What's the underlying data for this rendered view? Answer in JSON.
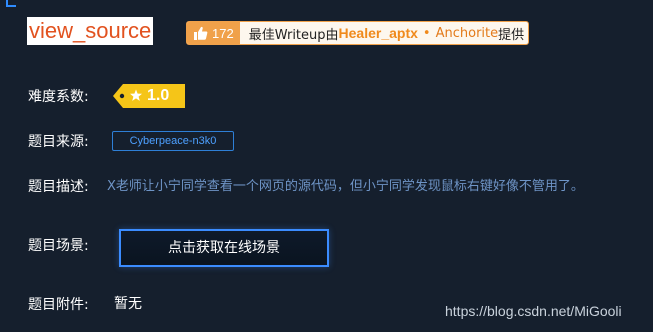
{
  "challenge": {
    "title": "view_source"
  },
  "writeup": {
    "likes": "172",
    "prefix": "最佳Writeup由",
    "author": "Healer_aptx",
    "separator": "•",
    "second_author": "Anchorite",
    "suffix": "提供"
  },
  "labels": {
    "difficulty": "难度系数:",
    "source": "题目来源:",
    "description": "题目描述:",
    "scene": "题目场景:",
    "attachment": "题目附件:"
  },
  "difficulty": {
    "value": "1.0",
    "badge_color": "#f5c518"
  },
  "source": {
    "value": "Cyberpeace-n3k0"
  },
  "description": {
    "text": "X老师让小宁同学查看一个网页的源代码，但小宁同学发现鼠标右键好像不管用了。"
  },
  "scene": {
    "button_label": "点击获取在线场景"
  },
  "attachment": {
    "value": "暂无"
  },
  "watermark": {
    "text": "https://blog.csdn.net/MiGooli"
  },
  "colors": {
    "background": "#151f2d",
    "accent_blue": "#3b8cff",
    "title_red": "#e2521f",
    "writeup_orange": "#f0a14a"
  },
  "icons": {
    "like": "thumbs-up-icon",
    "star": "star-icon"
  }
}
